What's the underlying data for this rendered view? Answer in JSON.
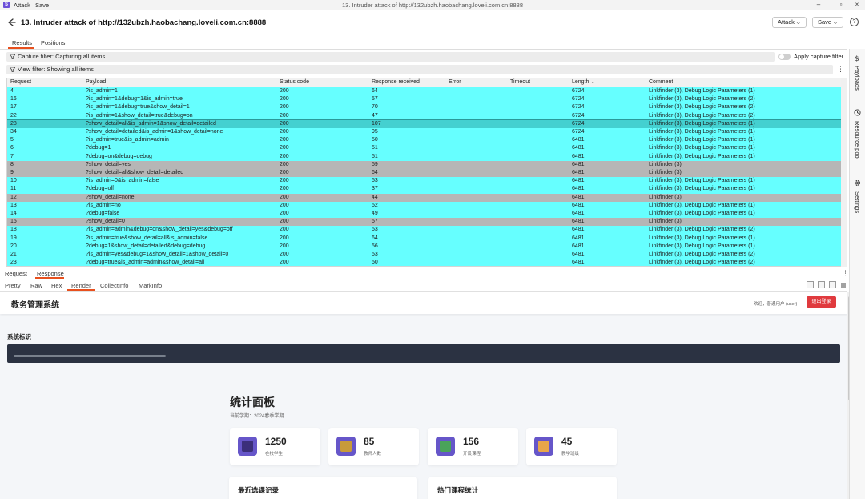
{
  "titlebar": {
    "app_logo": "S",
    "menu_attack": "Attack",
    "menu_save": "Save",
    "window_title": "13. Intruder attack of http://132ubzh.haobachang.loveli.com.cn:8888",
    "min": "–",
    "max": "▫",
    "close": "×"
  },
  "header": {
    "title": "13. Intruder attack of http://132ubzh.haobachang.loveli.com.cn:8888",
    "attack_btn": "Attack ⌵",
    "save_btn": "Save ⌵",
    "help": "?"
  },
  "tabs": {
    "results": "Results",
    "positions": "Positions"
  },
  "filters": {
    "capture": "Capture filter: Capturing all items",
    "apply_capture": "Apply capture filter",
    "view": "View filter: Showing all items",
    "more": "⋮"
  },
  "table": {
    "columns": [
      "Request",
      "Payload",
      "Status code",
      "Response received",
      "Error",
      "Timeout",
      "Length ⌄",
      "Comment"
    ],
    "rows": [
      {
        "req": "4",
        "payload": "?is_admin=1",
        "status": "200",
        "resp": "64",
        "len": "6724",
        "comment": "Linkfinder (3), Debug Logic Parameters (1)",
        "style": "cyan"
      },
      {
        "req": "16",
        "payload": "?is_admin=1&debug=1&is_admin=true",
        "status": "200",
        "resp": "57",
        "len": "6724",
        "comment": "Linkfinder (3), Debug Logic Parameters (2)",
        "style": "cyan"
      },
      {
        "req": "17",
        "payload": "?is_admin=1&debug=true&show_detail=1",
        "status": "200",
        "resp": "70",
        "len": "6724",
        "comment": "Linkfinder (3), Debug Logic Parameters (2)",
        "style": "cyan"
      },
      {
        "req": "22",
        "payload": "?is_admin=1&show_detail=true&debug=on",
        "status": "200",
        "resp": "47",
        "len": "6724",
        "comment": "Linkfinder (3), Debug Logic Parameters (2)",
        "style": "cyan"
      },
      {
        "req": "28",
        "payload": "?show_detail=all&is_admin=1&show_detail=detailed",
        "status": "200",
        "resp": "107",
        "len": "6724",
        "comment": "Linkfinder (3), Debug Logic Parameters (1)",
        "style": "sel"
      },
      {
        "req": "34",
        "payload": "?show_detail=detailed&is_admin=1&show_detail=none",
        "status": "200",
        "resp": "95",
        "len": "6724",
        "comment": "Linkfinder (3), Debug Logic Parameters (1)",
        "style": "cyan"
      },
      {
        "req": "5",
        "payload": "?is_admin=true&is_admin=admin",
        "status": "200",
        "resp": "50",
        "len": "6481",
        "comment": "Linkfinder (3), Debug Logic Parameters (1)",
        "style": "cyan"
      },
      {
        "req": "6",
        "payload": "?debug=1",
        "status": "200",
        "resp": "51",
        "len": "6481",
        "comment": "Linkfinder (3), Debug Logic Parameters (1)",
        "style": "cyan"
      },
      {
        "req": "7",
        "payload": "?debug=on&debug=debug",
        "status": "200",
        "resp": "51",
        "len": "6481",
        "comment": "Linkfinder (3), Debug Logic Parameters (1)",
        "style": "cyan"
      },
      {
        "req": "8",
        "payload": "?show_detail=yes",
        "status": "200",
        "resp": "59",
        "len": "6481",
        "comment": "Linkfinder (3)",
        "style": "gray"
      },
      {
        "req": "9",
        "payload": "?show_detail=all&show_detail=detailed",
        "status": "200",
        "resp": "64",
        "len": "6481",
        "comment": "Linkfinder (3)",
        "style": "gray"
      },
      {
        "req": "10",
        "payload": "?is_admin=0&is_admin=false",
        "status": "200",
        "resp": "53",
        "len": "6481",
        "comment": "Linkfinder (3), Debug Logic Parameters (1)",
        "style": "cyan"
      },
      {
        "req": "11",
        "payload": "?debug=off",
        "status": "200",
        "resp": "37",
        "len": "6481",
        "comment": "Linkfinder (3), Debug Logic Parameters (1)",
        "style": "cyan"
      },
      {
        "req": "12",
        "payload": "?show_detail=none",
        "status": "200",
        "resp": "44",
        "len": "6481",
        "comment": "Linkfinder (3)",
        "style": "gray"
      },
      {
        "req": "13",
        "payload": "?is_admin=no",
        "status": "200",
        "resp": "52",
        "len": "6481",
        "comment": "Linkfinder (3), Debug Logic Parameters (1)",
        "style": "cyan"
      },
      {
        "req": "14",
        "payload": "?debug=false",
        "status": "200",
        "resp": "49",
        "len": "6481",
        "comment": "Linkfinder (3), Debug Logic Parameters (1)",
        "style": "cyan"
      },
      {
        "req": "15",
        "payload": "?show_detail=0",
        "status": "200",
        "resp": "57",
        "len": "6481",
        "comment": "Linkfinder (3)",
        "style": "gray"
      },
      {
        "req": "18",
        "payload": "?is_admin=admin&debug=on&show_detail=yes&debug=off",
        "status": "200",
        "resp": "53",
        "len": "6481",
        "comment": "Linkfinder (3), Debug Logic Parameters (2)",
        "style": "cyan"
      },
      {
        "req": "19",
        "payload": "?is_admin=true&show_detail=all&is_admin=false",
        "status": "200",
        "resp": "64",
        "len": "6481",
        "comment": "Linkfinder (3), Debug Logic Parameters (1)",
        "style": "cyan"
      },
      {
        "req": "20",
        "payload": "?debug=1&show_detail=detailed&debug=debug",
        "status": "200",
        "resp": "56",
        "len": "6481",
        "comment": "Linkfinder (3), Debug Logic Parameters (1)",
        "style": "cyan"
      },
      {
        "req": "21",
        "payload": "?is_admin=yes&debug=1&show_detail=1&show_detail=0",
        "status": "200",
        "resp": "53",
        "len": "6481",
        "comment": "Linkfinder (3), Debug Logic Parameters (2)",
        "style": "cyan"
      },
      {
        "req": "23",
        "payload": "?debug=true&is_admin=admin&show_detail=all",
        "status": "200",
        "resp": "50",
        "len": "6481",
        "comment": "Linkfinder (3), Debug Logic Parameters (2)",
        "style": "cyan"
      }
    ]
  },
  "rr_tabs": {
    "request": "Request",
    "response": "Response",
    "more": "⋮"
  },
  "subtabs": {
    "pretty": "Pretty",
    "raw": "Raw",
    "hex": "Hex",
    "render": "Render",
    "collectinfo": "CollectInfo",
    "markinfo": "MarkInfo"
  },
  "render": {
    "site_title": "教务管理系统",
    "welcome": "欢迎，普通用户 (user)",
    "logout": "退出登录",
    "sysid_label": "系统标识",
    "dash_title": "统计面板",
    "dash_sub": "当前学期：2024春季学期",
    "stats": [
      {
        "num": "1250",
        "label": "在校学生",
        "color": "#3b2f7a"
      },
      {
        "num": "85",
        "label": "教师人数",
        "color": "#c79a3a"
      },
      {
        "num": "156",
        "label": "开设课程",
        "color": "#4aa35a"
      },
      {
        "num": "45",
        "label": "教学班级",
        "color": "#e8a64a"
      }
    ],
    "panel_left": "最近选课记录",
    "panel_right": "热门课程统计"
  },
  "sidebar": {
    "payloads": "Payloads",
    "resource_pool": "Resource pool",
    "settings": "Settings"
  },
  "colors": {
    "accent": "#e8501e",
    "cyan_row": "#66ffff",
    "gray_row": "#b6b6b6",
    "logout": "#e03a3e"
  }
}
